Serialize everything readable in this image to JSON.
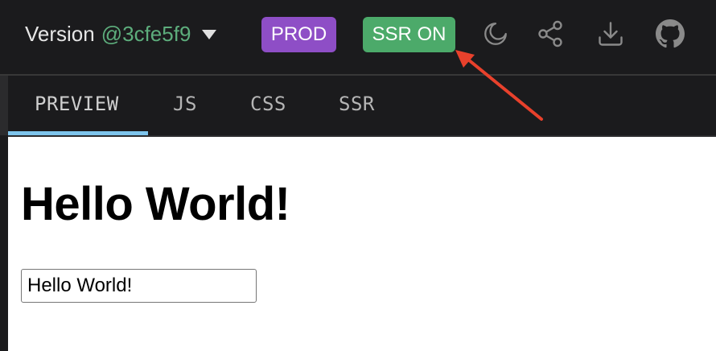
{
  "header": {
    "version_label": "Version",
    "version_hash": "@3cfe5f9",
    "prod_label": "PROD",
    "ssr_label": "SSR ON",
    "icons": [
      "moon-icon",
      "share-icon",
      "download-icon",
      "github-icon"
    ]
  },
  "tabs": [
    {
      "label": "PREVIEW",
      "active": true
    },
    {
      "label": "JS",
      "active": false
    },
    {
      "label": "CSS",
      "active": false
    },
    {
      "label": "SSR",
      "active": false
    }
  ],
  "preview": {
    "heading": "Hello World!",
    "input_value": "Hello World!"
  },
  "colors": {
    "prod": "#8e4ec6",
    "ssr_on": "#4caa6a",
    "hash": "#5dad7c",
    "active_tab_underline": "#7dc4ec",
    "annotation_arrow": "#e8412c"
  }
}
